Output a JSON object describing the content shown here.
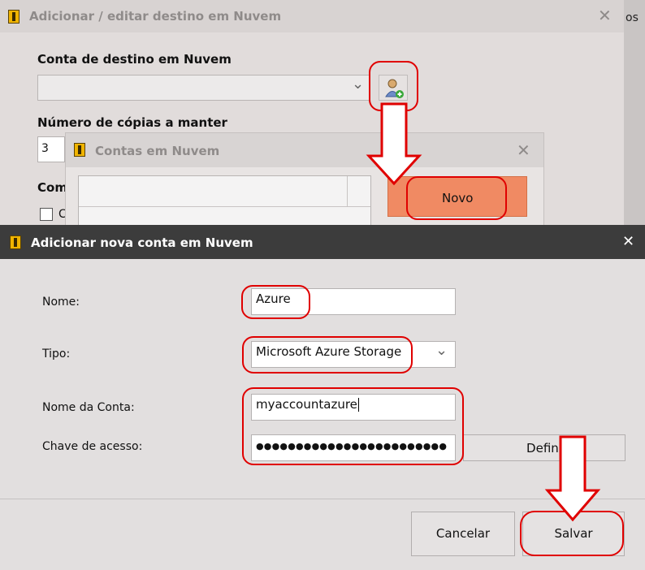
{
  "background_window": {
    "title": "Adicionar / editar destino em Nuvem",
    "right_edge_text": "os",
    "cloud_account_label": "Conta de destino em Nuvem",
    "cloud_account_value": "",
    "copies_label": "Número de cópias a manter",
    "copies_value": "3",
    "partial_label": "Com",
    "partial_checkbox_text": "C"
  },
  "accounts_window": {
    "title": "Contas em Nuvem",
    "new_button": "Novo"
  },
  "dialog": {
    "title": "Adicionar nova conta em Nuvem",
    "close_glyph": "✕",
    "name_label": "Nome:",
    "name_value": "Azure",
    "type_label": "Tipo:",
    "type_value": "Microsoft Azure Storage",
    "account_name_label": "Nome da Conta:",
    "account_name_value": "myaccountazure",
    "access_key_label": "Chave de acesso:",
    "access_key_value": "●●●●●●●●●●●●●●●●●●●●●●●●",
    "define_button": "Defini",
    "cancel_button": "Cancelar",
    "save_button": "Salvar"
  },
  "glyphs": {
    "close": "✕",
    "dropdown": "⌄"
  },
  "icons": [
    "app-icon",
    "add-account-icon",
    "chevron-down-icon",
    "close-icon",
    "arrow-down-icon"
  ],
  "colors": {
    "highlight": "#e00000",
    "new_button": "#f08a63",
    "dialog_titlebar": "#3c3c3c"
  }
}
